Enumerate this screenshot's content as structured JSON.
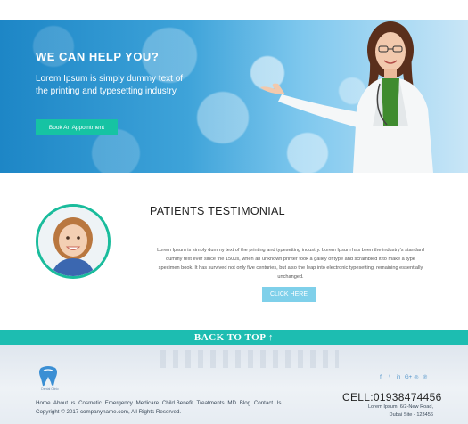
{
  "hero": {
    "title": "WE CAN HELP YOU?",
    "text": "Lorem Ipsum is simply dummy text of the printing and typesetting industry.",
    "button_label": "Book An Appointment"
  },
  "testimonial": {
    "title": "PATIENTS TESTIMONIAL",
    "text": "Lorem Ipsum is simply dummy text of the printing and typesetting industry. Lorem Ipsum has been the industry's standard dummy text ever since the 1500s, when an unknown printer took a galley of type and scrambled it to make a type specimen book. It has survived not only five centuries, but also the leap into electronic typesetting, remaining essentially unchanged.",
    "button_label": "CLICK HERE"
  },
  "back_to_top": "BACK TO TOP ↑",
  "footer": {
    "logo_text": "Dental Clinic",
    "nav": [
      "Home",
      "About us",
      "Cosmetic",
      "Emergency",
      "Medicare",
      "Child Benefit",
      "Treatments",
      "MD",
      "Blog",
      "Contact Us"
    ],
    "copyright": "Copyright © 2017 companyname.com, All Rights Reserved.",
    "social_icons": [
      "facebook-icon",
      "twitter-icon",
      "linkedin-icon",
      "google-plus-icon",
      "instagram-icon",
      "pinterest-icon"
    ],
    "social_glyphs": [
      "f",
      "ᵗ",
      "in",
      "G+",
      "◎",
      "℗"
    ],
    "cell": "CELL:01938474456",
    "address_line1": "Lorem Ipsum, 6/2-New Road,",
    "address_line2": "Dubai Site - 123456"
  },
  "colors": {
    "accent": "#1dbdb1",
    "button_green": "#16c3a3",
    "button_blue": "#7fd0ea"
  }
}
